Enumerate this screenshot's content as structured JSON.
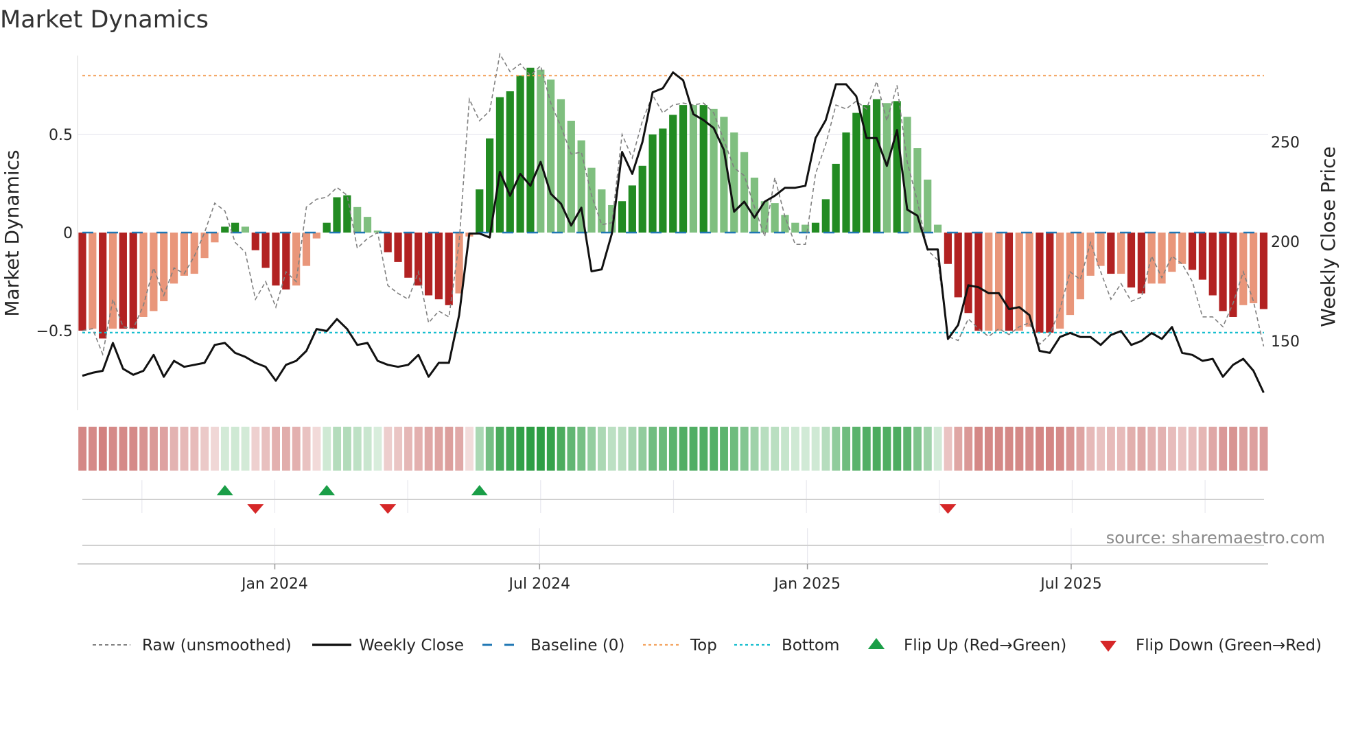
{
  "chart_data": {
    "type": "bar",
    "title": "Market Dynamics",
    "ylabel": "Market Dynamics",
    "y2label": "Weekly Close Price",
    "ylim": [
      -0.93,
      0.9
    ],
    "y2lim": [
      120,
      295
    ],
    "yticks": [
      {
        "v": 0.5,
        "label": "0.5"
      },
      {
        "v": 0,
        "label": "0"
      },
      {
        "v": -0.5,
        "label": "−0.5"
      }
    ],
    "y2ticks": [
      {
        "v": 250,
        "label": "250"
      },
      {
        "v": 200,
        "label": "200"
      },
      {
        "v": 150,
        "label": "150"
      }
    ],
    "xticks": [
      {
        "week": 18.9,
        "label": "Jan 2024"
      },
      {
        "week": 44.9,
        "label": "Jul 2024"
      },
      {
        "week": 71.2,
        "label": "Jan 2025"
      },
      {
        "week": 97.1,
        "label": "Jul 2025"
      }
    ],
    "x_unit": "week index",
    "top_level": 0.8,
    "bottom_level": -0.51,
    "baseline": 0,
    "colors": {
      "neg_dark": "#b22222",
      "neg_light": "#e9967a",
      "pos_dark": "#228b22",
      "pos_light": "#7fbf7f",
      "raw": "#808080",
      "close": "#111111",
      "baseline": "#1f77b4",
      "top": "#f4a460",
      "bottom": "#17becf",
      "flip_up": "#1a9e47",
      "flip_down": "#d62728"
    },
    "dynamics": [
      -0.5,
      -0.49,
      -0.54,
      -0.49,
      -0.49,
      -0.49,
      -0.43,
      -0.4,
      -0.35,
      -0.26,
      -0.22,
      -0.21,
      -0.13,
      -0.05,
      0.03,
      0.05,
      0.03,
      -0.09,
      -0.18,
      -0.27,
      -0.29,
      -0.27,
      -0.17,
      -0.03,
      0.05,
      0.18,
      0.19,
      0.13,
      0.08,
      0.01,
      -0.1,
      -0.15,
      -0.23,
      -0.27,
      -0.32,
      -0.34,
      -0.37,
      -0.31,
      -0.02,
      0.22,
      0.48,
      0.69,
      0.72,
      0.8,
      0.84,
      0.83,
      0.78,
      0.68,
      0.57,
      0.47,
      0.33,
      0.22,
      0.14,
      0.16,
      0.24,
      0.34,
      0.5,
      0.53,
      0.6,
      0.65,
      0.65,
      0.65,
      0.63,
      0.59,
      0.51,
      0.41,
      0.28,
      0.16,
      0.15,
      0.09,
      0.05,
      0.04,
      0.05,
      0.17,
      0.35,
      0.51,
      0.61,
      0.65,
      0.68,
      0.66,
      0.67,
      0.59,
      0.43,
      0.27,
      0.04,
      -0.16,
      -0.33,
      -0.41,
      -0.5,
      -0.5,
      -0.5,
      -0.5,
      -0.5,
      -0.48,
      -0.51,
      -0.51,
      -0.49,
      -0.42,
      -0.34,
      -0.22,
      -0.17,
      -0.21,
      -0.21,
      -0.28,
      -0.31,
      -0.26,
      -0.26,
      -0.2,
      -0.16,
      -0.19,
      -0.24,
      -0.32,
      -0.4,
      -0.43,
      -0.37,
      -0.36,
      -0.39
    ],
    "shade": "DLDLDDLLLLLLLLDDLDDDDLLLDDDLLLDDDDDDDLLDDDDDDLLLLLLLLDDDDDDDLDLLLLLLLLLLDDDDDDDLDLLLLDDDDLLDLLDDLLLLLDLDDLLLLDDDDDLLD",
    "raw": [
      -0.5,
      -0.49,
      -0.62,
      -0.34,
      -0.48,
      -0.49,
      -0.37,
      -0.18,
      -0.32,
      -0.18,
      -0.21,
      -0.12,
      0,
      0.15,
      0.11,
      -0.05,
      -0.1,
      -0.34,
      -0.25,
      -0.38,
      -0.2,
      -0.25,
      0.13,
      0.17,
      0.18,
      0.23,
      0.19,
      -0.08,
      -0.03,
      0,
      -0.27,
      -0.31,
      -0.34,
      -0.2,
      -0.46,
      -0.4,
      -0.43,
      -0.05,
      0.68,
      0.57,
      0.62,
      0.91,
      0.82,
      0.86,
      0.8,
      0.85,
      0.66,
      0.54,
      0.4,
      0.41,
      0.19,
      0.04,
      0.05,
      0.5,
      0.38,
      0.57,
      0.7,
      0.61,
      0.65,
      0.66,
      0.65,
      0.66,
      0.61,
      0.47,
      0.33,
      0.29,
      0.13,
      -0.02,
      0.28,
      0.08,
      -0.06,
      -0.06,
      0.3,
      0.45,
      0.65,
      0.63,
      0.67,
      0.63,
      0.77,
      0.57,
      0.75,
      0.36,
      0.16,
      -0.09,
      -0.14,
      -0.53,
      -0.55,
      -0.44,
      -0.49,
      -0.53,
      -0.49,
      -0.52,
      -0.48,
      -0.46,
      -0.57,
      -0.52,
      -0.39,
      -0.2,
      -0.24,
      -0.05,
      -0.2,
      -0.34,
      -0.26,
      -0.35,
      -0.33,
      -0.12,
      -0.23,
      -0.12,
      -0.16,
      -0.25,
      -0.43,
      -0.43,
      -0.48,
      -0.36,
      -0.2,
      -0.35,
      -0.58
    ],
    "close": [
      132.5,
      134,
      135,
      149,
      136,
      133,
      135,
      143,
      132,
      140,
      137,
      138,
      139,
      148,
      149,
      144,
      142,
      139,
      137,
      130,
      138,
      140,
      145,
      156,
      155,
      161,
      156,
      148,
      149,
      140,
      138,
      137,
      138,
      143,
      132,
      139,
      139,
      163,
      204,
      204,
      202,
      235,
      223,
      234,
      228,
      240,
      224,
      219,
      208,
      217,
      185,
      186,
      204,
      245,
      234,
      250,
      275,
      277,
      285,
      281,
      264,
      261,
      257,
      246,
      215,
      220,
      212,
      220,
      223,
      227,
      227,
      228,
      252,
      261,
      279,
      279,
      273,
      252,
      252,
      238,
      256,
      216,
      213,
      196,
      196,
      151,
      158,
      178,
      177,
      174,
      174,
      166,
      167,
      163,
      145,
      144,
      152,
      154,
      152,
      152,
      148,
      153,
      155,
      148,
      150,
      154,
      151,
      157,
      144,
      143,
      140,
      141,
      132,
      138,
      141,
      135,
      124
    ],
    "flip_up_weeks": [
      14,
      24,
      39
    ],
    "flip_down_weeks": [
      17,
      30,
      85
    ],
    "legend": {
      "placement": "bottom",
      "entries": [
        "Raw (unsmoothed)",
        "Weekly Close",
        "Baseline (0)",
        "Top",
        "Bottom",
        "Flip Up (Red→Green)",
        "Flip Down (Green→Red)"
      ]
    },
    "source": "source: sharemaestro.com"
  }
}
